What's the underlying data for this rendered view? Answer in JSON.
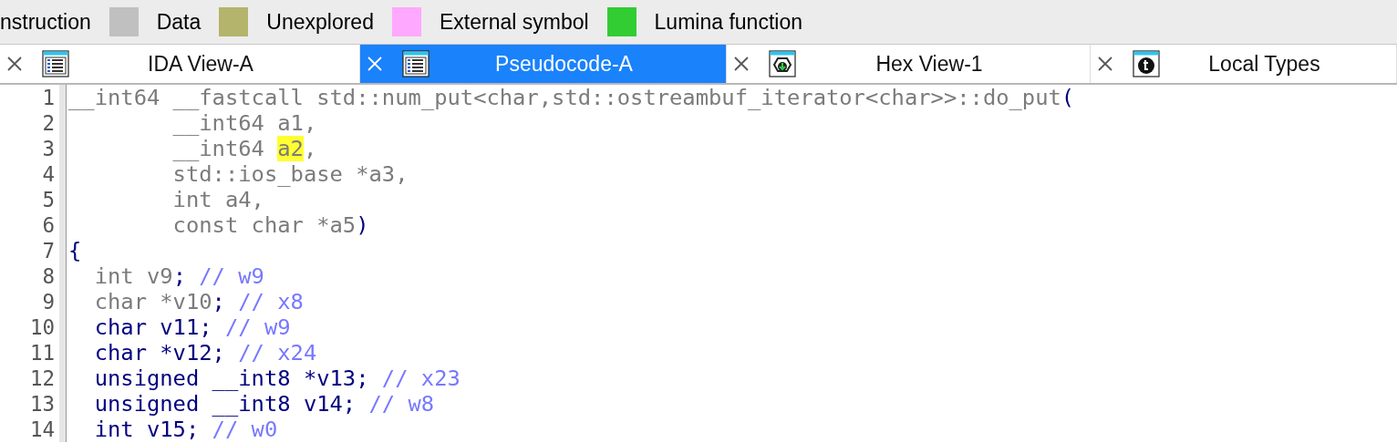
{
  "legend": [
    {
      "label": "nstruction"
    },
    {
      "label": "Data",
      "color": "#c0c0c0"
    },
    {
      "label": "Unexplored",
      "color": "#b4b46c"
    },
    {
      "label": "External symbol",
      "color": "#ffa8ff"
    },
    {
      "label": "Lumina function",
      "color": "#32cd32"
    }
  ],
  "tabs": [
    {
      "label": "IDA View-A",
      "kind": "listing",
      "selected": false
    },
    {
      "label": "Pseudocode-A",
      "kind": "listing",
      "selected": true
    },
    {
      "label": "Hex View-1",
      "kind": "hex",
      "selected": false
    },
    {
      "label": "Local Types",
      "kind": "types",
      "selected": false
    }
  ],
  "code": [
    {
      "number": "1",
      "segments": [
        {
          "kind": "gray",
          "text": "__int64 __fastcall std::num_put<char,std::ostreambuf_iterator<char>>::do_put"
        },
        {
          "kind": "code",
          "text": "("
        }
      ]
    },
    {
      "number": "2",
      "segments": [
        {
          "kind": "gray",
          "text": "        __int64 a1,"
        }
      ]
    },
    {
      "number": "3",
      "segments": [
        {
          "kind": "gray",
          "text": "        __int64 "
        },
        {
          "kind": "highlight",
          "text": "a2"
        },
        {
          "kind": "gray",
          "text": ","
        }
      ]
    },
    {
      "number": "4",
      "segments": [
        {
          "kind": "gray",
          "text": "        std::ios_base *a3,"
        }
      ]
    },
    {
      "number": "5",
      "segments": [
        {
          "kind": "gray",
          "text": "        int a4,"
        }
      ]
    },
    {
      "number": "6",
      "segments": [
        {
          "kind": "gray",
          "text": "        const char *a5"
        },
        {
          "kind": "code",
          "text": ")"
        }
      ]
    },
    {
      "number": "7",
      "segments": [
        {
          "kind": "code",
          "text": "{"
        }
      ]
    },
    {
      "number": "8",
      "segments": [
        {
          "kind": "gray",
          "text": "  int v9"
        },
        {
          "kind": "code",
          "text": "; "
        },
        {
          "kind": "comment",
          "text": "// w9"
        }
      ]
    },
    {
      "number": "9",
      "segments": [
        {
          "kind": "gray",
          "text": "  char *v10"
        },
        {
          "kind": "code",
          "text": "; "
        },
        {
          "kind": "comment",
          "text": "// x8"
        }
      ]
    },
    {
      "number": "10",
      "segments": [
        {
          "kind": "code",
          "text": "  char v11; "
        },
        {
          "kind": "comment",
          "text": "// w9"
        }
      ]
    },
    {
      "number": "11",
      "segments": [
        {
          "kind": "code",
          "text": "  char *v12; "
        },
        {
          "kind": "comment",
          "text": "// x24"
        }
      ]
    },
    {
      "number": "12",
      "segments": [
        {
          "kind": "code",
          "text": "  unsigned __int8 *v13; "
        },
        {
          "kind": "comment",
          "text": "// x23"
        }
      ]
    },
    {
      "number": "13",
      "segments": [
        {
          "kind": "code",
          "text": "  unsigned __int8 v14; "
        },
        {
          "kind": "comment",
          "text": "// w8"
        }
      ]
    },
    {
      "number": "14",
      "segments": [
        {
          "kind": "code",
          "text": "  int v15; "
        },
        {
          "kind": "comment",
          "text": "// w0"
        }
      ]
    }
  ]
}
